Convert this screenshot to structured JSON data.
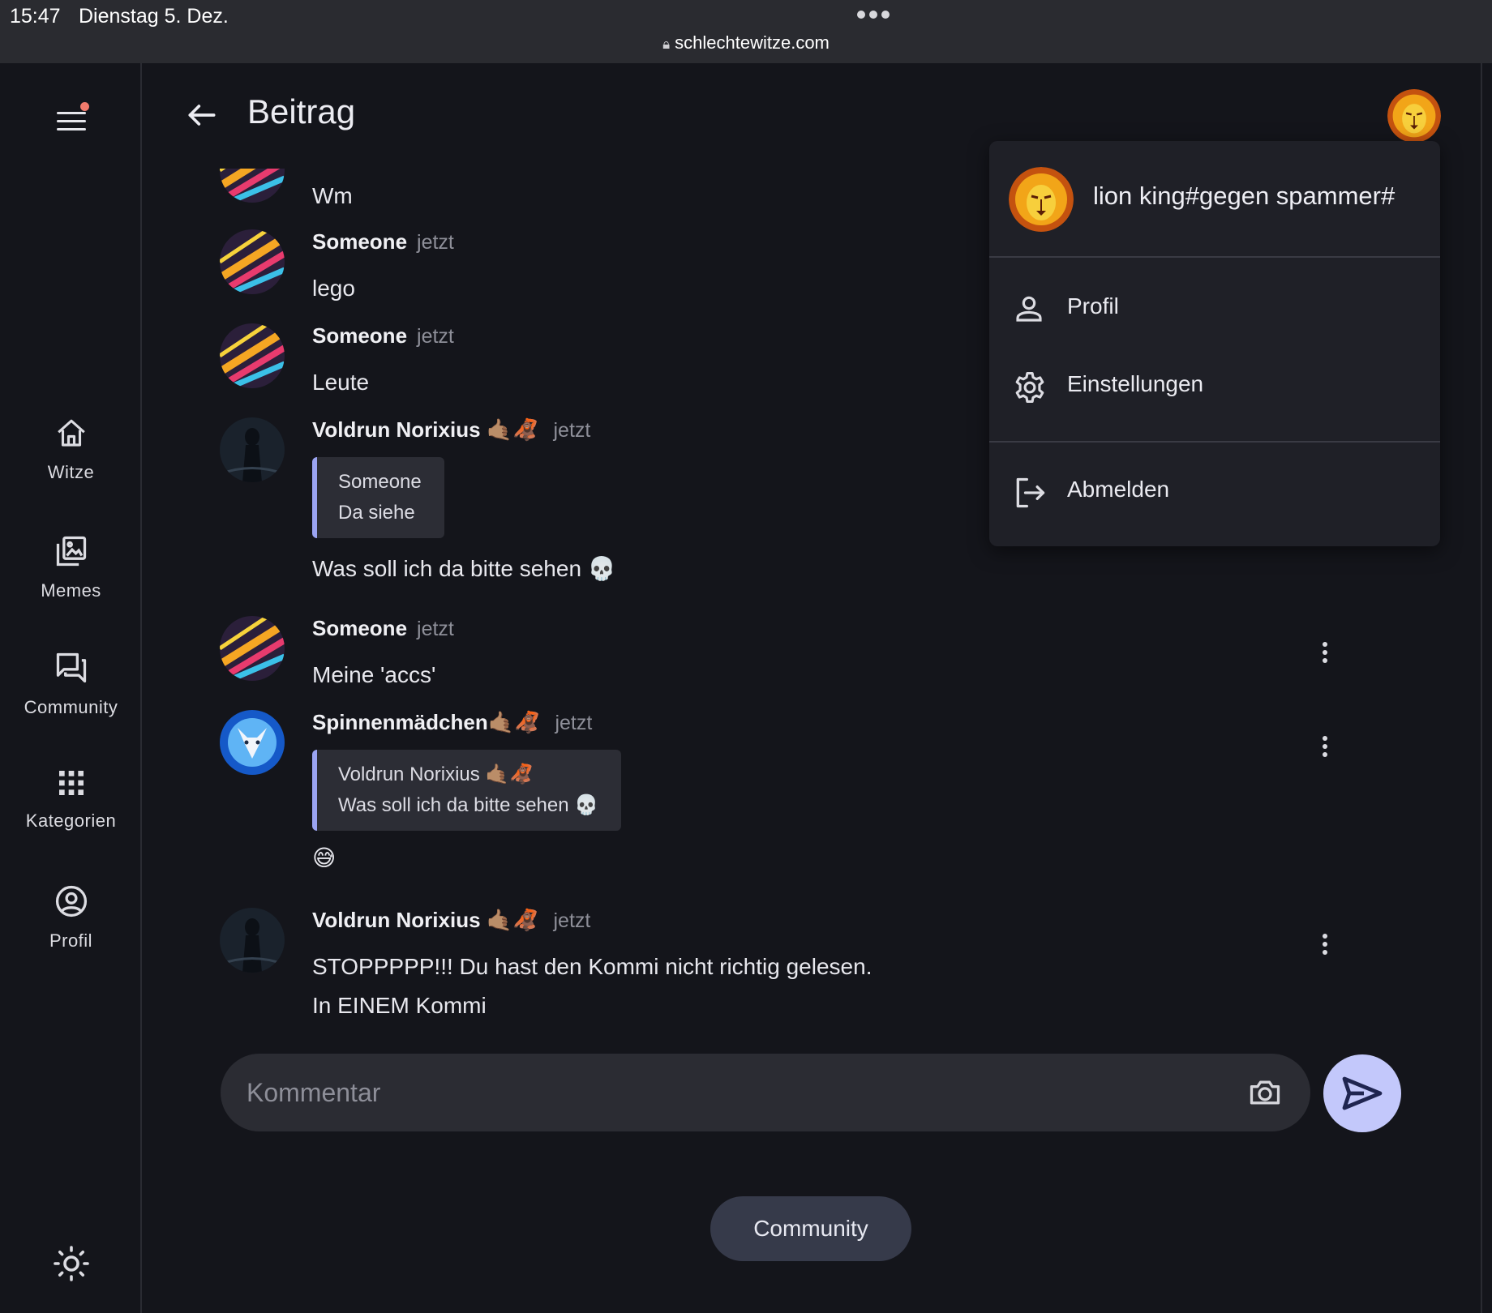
{
  "status_bar": {
    "time": "15:47",
    "date": "Dienstag 5. Dez.",
    "url": "schlechtewitze.com"
  },
  "sidebar": {
    "items": [
      {
        "label": "Witze",
        "icon": "home-icon"
      },
      {
        "label": "Memes",
        "icon": "image-stack-icon"
      },
      {
        "label": "Community",
        "icon": "forum-icon"
      },
      {
        "label": "Kategorien",
        "icon": "grid-icon"
      },
      {
        "label": "Profil",
        "icon": "account-circle-icon"
      }
    ]
  },
  "header": {
    "title": "Beitrag"
  },
  "comments": [
    {
      "author": "",
      "time": "",
      "text": "Wm",
      "avatar": "abstract-avatar"
    },
    {
      "author": "Someone",
      "time": "jetzt",
      "text": "lego",
      "avatar": "abstract-avatar"
    },
    {
      "author": "Someone",
      "time": "jetzt",
      "text": "Leute",
      "avatar": "abstract-avatar"
    },
    {
      "author": "Voldrun Norixius 🤙🏽🦧",
      "time": "jetzt",
      "quote_author": "Someone",
      "quote_text": "Da siehe",
      "text": "Was soll ich da bitte sehen 💀",
      "avatar": "dark-figure-avatar"
    },
    {
      "author": "Someone",
      "time": "jetzt",
      "text": "Meine 'accs'",
      "avatar": "abstract-avatar"
    },
    {
      "author": "Spinnenmädchen🤙🏽🦧",
      "time": "jetzt",
      "quote_author": "Voldrun Norixius 🤙🏽🦧",
      "quote_text": "Was soll ich da bitte sehen 💀",
      "text": "😅",
      "avatar": "wolf-avatar"
    },
    {
      "author": "Voldrun Norixius 🤙🏽🦧",
      "time": "jetzt",
      "text": "STOPPPPP!!! Du hast den Kommi nicht richtig gelesen.",
      "text2": "In EINEM Kommi",
      "avatar": "dark-figure-avatar"
    }
  ],
  "comment_input": {
    "placeholder": "Kommentar"
  },
  "community_button": "Community",
  "user_menu": {
    "username": "lion king#gegen spammer#",
    "items": [
      {
        "label": "Profil",
        "icon": "person-icon"
      },
      {
        "label": "Einstellungen",
        "icon": "gear-icon"
      },
      {
        "label": "Abmelden",
        "icon": "logout-icon"
      }
    ]
  },
  "colors": {
    "background": "#14151b",
    "accent": "#c3c8fb",
    "quote_border": "#9ba4f2",
    "notification_dot": "#f07a6c"
  }
}
